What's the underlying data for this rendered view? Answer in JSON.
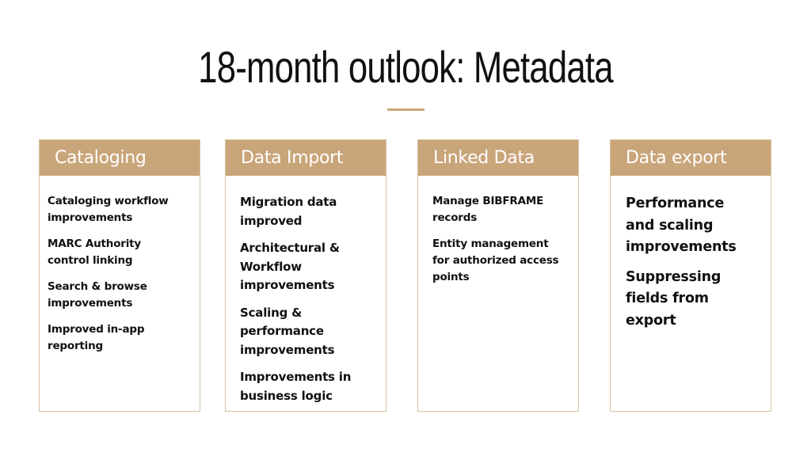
{
  "slide": {
    "title": "18-month outlook: Metadata",
    "accent_color": "#c9a57a"
  },
  "columns": [
    {
      "heading": "Cataloging",
      "items": [
        "Cataloging workflow improvements",
        "MARC Authority control linking",
        "Search & browse improvements",
        "Improved in-app reporting"
      ]
    },
    {
      "heading": "Data Import",
      "items": [
        "Migration data improved",
        "Architectural & Workflow improvements",
        "Scaling & performance improvements",
        "Improvements in business logic"
      ]
    },
    {
      "heading": "Linked Data",
      "items": [
        "Manage BIBFRAME records",
        "Entity management for authorized access points"
      ]
    },
    {
      "heading": "Data export",
      "items": [
        "Performance and scaling improvements",
        "Suppressing fields from export"
      ]
    }
  ]
}
